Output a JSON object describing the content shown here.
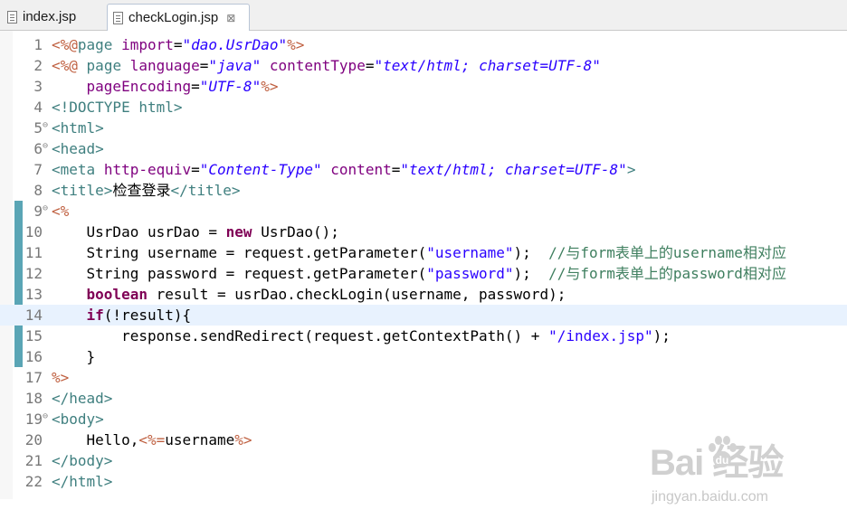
{
  "tabs": [
    {
      "label": "index.jsp",
      "icon": "jsp-file-icon",
      "active": false
    },
    {
      "label": "checkLogin.jsp",
      "icon": "jsp-file-icon",
      "active": true,
      "close": "⊠"
    }
  ],
  "lines": [
    {
      "n": "1",
      "t": [
        [
          "dl",
          "<%@"
        ],
        [
          "tg",
          "page"
        ],
        [
          "p",
          " "
        ],
        [
          "at",
          "import"
        ],
        [
          "p",
          "="
        ],
        [
          "av",
          "\"dao.UsrDao\""
        ],
        [
          "dl",
          "%>"
        ]
      ]
    },
    {
      "n": "2",
      "t": [
        [
          "dl",
          "<%@"
        ],
        [
          "p",
          " "
        ],
        [
          "tg",
          "page"
        ],
        [
          "p",
          " "
        ],
        [
          "at",
          "language"
        ],
        [
          "p",
          "="
        ],
        [
          "av",
          "\"java\""
        ],
        [
          "p",
          " "
        ],
        [
          "at",
          "contentType"
        ],
        [
          "p",
          "="
        ],
        [
          "av",
          "\"text/html; charset=UTF-8\""
        ]
      ]
    },
    {
      "n": "3",
      "t": [
        [
          "p",
          "    "
        ],
        [
          "at",
          "pageEncoding"
        ],
        [
          "p",
          "="
        ],
        [
          "av",
          "\"UTF-8\""
        ],
        [
          "dl",
          "%>"
        ]
      ]
    },
    {
      "n": "4",
      "t": [
        [
          "tg",
          "<!DOCTYPE html>"
        ]
      ]
    },
    {
      "n": "5",
      "fold": "⊖",
      "t": [
        [
          "tg",
          "<html>"
        ]
      ]
    },
    {
      "n": "6",
      "fold": "⊖",
      "t": [
        [
          "tg",
          "<head>"
        ]
      ]
    },
    {
      "n": "7",
      "t": [
        [
          "tg",
          "<meta"
        ],
        [
          "p",
          " "
        ],
        [
          "at",
          "http-equiv"
        ],
        [
          "p",
          "="
        ],
        [
          "av",
          "\"Content-Type\""
        ],
        [
          "p",
          " "
        ],
        [
          "at",
          "content"
        ],
        [
          "p",
          "="
        ],
        [
          "av",
          "\"text/html; charset=UTF-8\""
        ],
        [
          "tg",
          ">"
        ]
      ]
    },
    {
      "n": "8",
      "t": [
        [
          "tg",
          "<title>"
        ],
        [
          "p",
          "检查登录"
        ],
        [
          "tg",
          "</title>"
        ]
      ]
    },
    {
      "n": "9",
      "fold": "⊖",
      "t": [
        [
          "dl",
          "<%"
        ]
      ]
    },
    {
      "n": "10",
      "t": [
        [
          "p",
          "    UsrDao usrDao = "
        ],
        [
          "kw",
          "new"
        ],
        [
          "p",
          " UsrDao();"
        ]
      ]
    },
    {
      "n": "11",
      "t": [
        [
          "p",
          "    String username = request.getParameter("
        ],
        [
          "st",
          "\"username\""
        ],
        [
          "p",
          ");  "
        ],
        [
          "cm",
          "//与form表单上的username相对应"
        ]
      ]
    },
    {
      "n": "12",
      "t": [
        [
          "p",
          "    String password = request.getParameter("
        ],
        [
          "st",
          "\"password\""
        ],
        [
          "p",
          ");  "
        ],
        [
          "cm",
          "//与form表单上的password相对应"
        ]
      ]
    },
    {
      "n": "13",
      "t": [
        [
          "p",
          "    "
        ],
        [
          "kw",
          "boolean"
        ],
        [
          "p",
          " result = usrDao.checkLogin(username, password);"
        ]
      ]
    },
    {
      "n": "14",
      "hl": true,
      "t": [
        [
          "p",
          "    "
        ],
        [
          "kw",
          "if"
        ],
        [
          "p",
          "(!result){"
        ]
      ]
    },
    {
      "n": "15",
      "t": [
        [
          "p",
          "        response.sendRedirect(request.getContextPath() + "
        ],
        [
          "st",
          "\"/index.jsp\""
        ],
        [
          "p",
          ");"
        ]
      ]
    },
    {
      "n": "16",
      "t": [
        [
          "p",
          "    }"
        ]
      ]
    },
    {
      "n": "17",
      "t": [
        [
          "dl",
          "%>"
        ]
      ]
    },
    {
      "n": "18",
      "t": [
        [
          "tg",
          "</head>"
        ]
      ]
    },
    {
      "n": "19",
      "fold": "⊖",
      "t": [
        [
          "tg",
          "<body>"
        ]
      ]
    },
    {
      "n": "20",
      "t": [
        [
          "p",
          "    Hello,"
        ],
        [
          "dl",
          "<%="
        ],
        [
          "p",
          "username"
        ],
        [
          "dl",
          "%>"
        ]
      ]
    },
    {
      "n": "21",
      "t": [
        [
          "tg",
          "</body>"
        ]
      ]
    },
    {
      "n": "22",
      "t": [
        [
          "tg",
          "</html>"
        ]
      ]
    }
  ],
  "watermark": {
    "brand": "Bai 经验",
    "site": "jingyan.baidu.com"
  }
}
